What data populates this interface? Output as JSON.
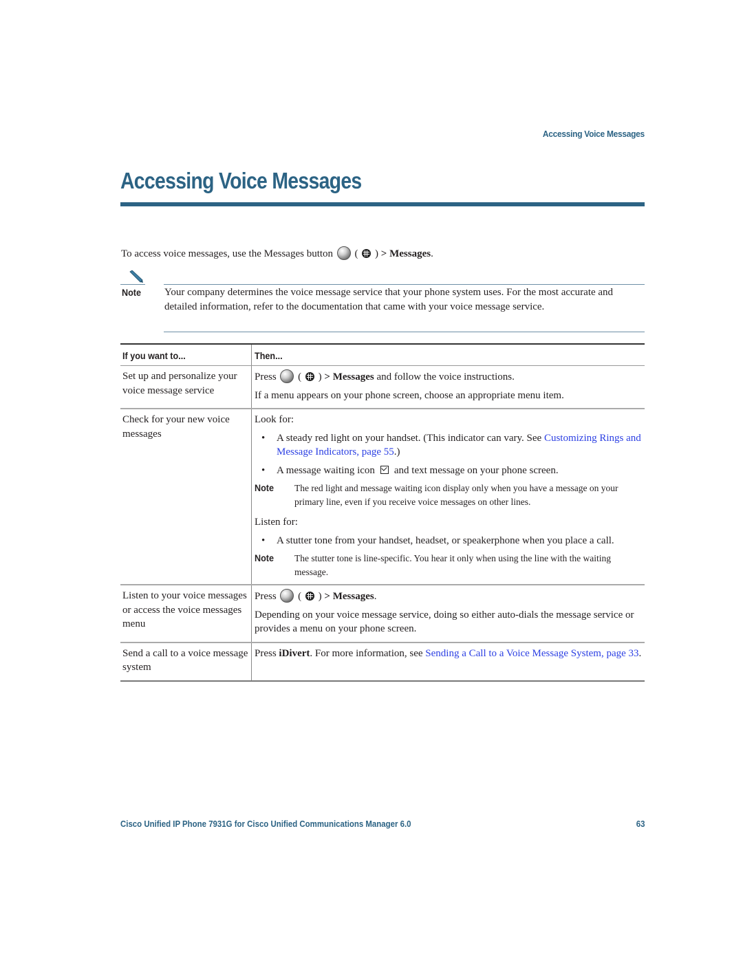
{
  "header": {
    "running_head": "Accessing Voice Messages",
    "title": "Accessing Voice Messages"
  },
  "intro": {
    "text_before": "To access voice messages, use the Messages button",
    "paren_open": "(",
    "paren_close": ")",
    "arrow": ">",
    "bold_item": "Messages",
    "period": ".",
    "icons": [
      "messages-button-icon",
      "globe-icon"
    ]
  },
  "note": {
    "label": "Note",
    "icon": "pencil-icon",
    "text": "Your company determines the voice message service that your phone system uses. For the most accurate and detailed information, refer to the documentation that came with your voice message service."
  },
  "table": {
    "headers": [
      "If you want to...",
      "Then..."
    ],
    "rows": [
      {
        "task": "Set up and personalize your voice message service",
        "press": "Press",
        "after_bold": "and follow the voice instructions.",
        "bold": "> Messages",
        "extra": "If a menu appears on your phone screen, choose an appropriate menu item."
      },
      {
        "task": "Check for your new voice messages",
        "look_for": "Look for:",
        "bullet1_text": "A steady red light on your handset. (This indicator can vary. See",
        "bullet1_link": "Customizing Rings and Message Indicators, page 55",
        "bullet1_tail": ".)",
        "bullet2_before": "A message waiting icon",
        "bullet2_after": "and text message on your phone screen.",
        "note1_label": "Note",
        "note1_text": "The red light and message waiting icon display only when you have a message on your primary line, even if you receive voice messages on other lines.",
        "listen_for": "Listen for:",
        "bullet3_text": "A stutter tone from your handset, headset, or speakerphone when you place a call.",
        "note2_label": "Note",
        "note2_text": "The stutter tone is line-specific. You hear it only when using the line with the waiting message."
      },
      {
        "task": "Listen to your voice messages or access the voice messages menu",
        "press": "Press",
        "bold": "> Messages",
        "tail": ".",
        "extra": "Depending on your voice message service, doing so either auto-dials the message service or provides a menu on your phone screen."
      },
      {
        "task": "Send a call to a voice message system",
        "press": "Press",
        "bold": "iDivert",
        "mid": ". For more information, see",
        "link": "Sending a Call to a Voice Message System, page 33",
        "tail": "."
      }
    ]
  },
  "footer": {
    "title": "Cisco Unified IP Phone 7931G for Cisco Unified Communications Manager 6.0",
    "page": "63"
  },
  "colors": {
    "heading": "#2c6384",
    "link": "#2b3fe3",
    "text": "#231f20"
  }
}
